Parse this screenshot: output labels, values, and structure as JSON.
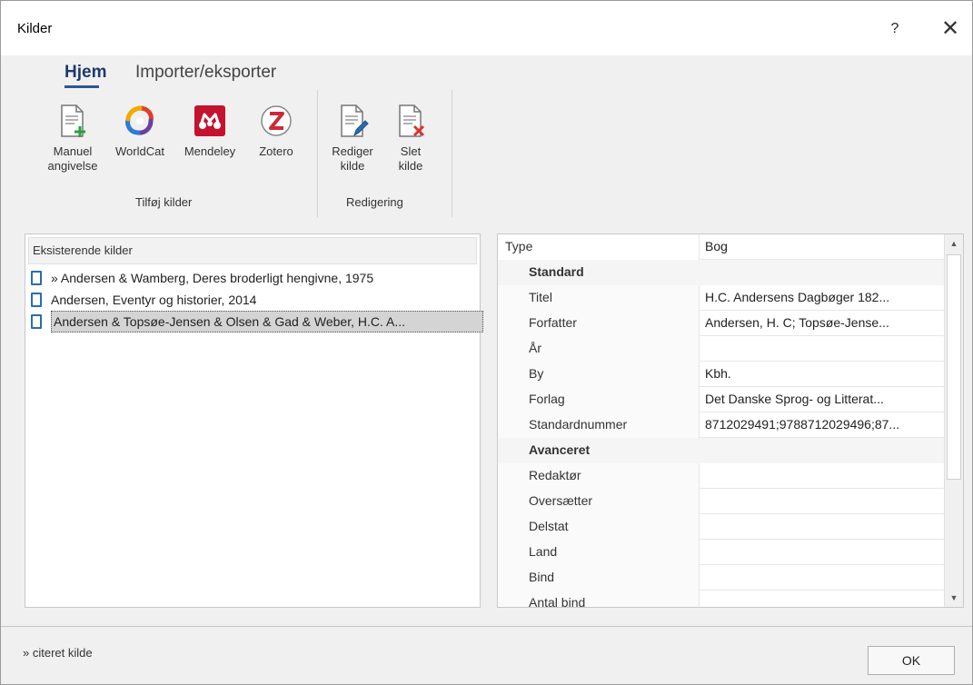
{
  "window": {
    "title": "Kilder",
    "help_label": "?",
    "close_label": "✕"
  },
  "ribbon": {
    "tabs": [
      {
        "label": "Hjem",
        "active": true
      },
      {
        "label": "Importer/eksporter",
        "active": false
      }
    ],
    "groups": [
      {
        "label": "Tilføj kilder",
        "buttons": [
          {
            "label": "Manuel angivelse",
            "line1": "Manuel",
            "line2": "angivelse",
            "icon": "manual-entry-icon"
          },
          {
            "label": "WorldCat",
            "icon": "worldcat-icon"
          },
          {
            "label": "Mendeley",
            "icon": "mendeley-icon"
          },
          {
            "label": "Zotero",
            "icon": "zotero-icon"
          }
        ]
      },
      {
        "label": "Redigering",
        "buttons": [
          {
            "label": "Rediger kilde",
            "line1": "Rediger",
            "line2": "kilde",
            "icon": "edit-source-icon"
          },
          {
            "label": "Slet kilde",
            "line1": "Slet",
            "line2": "kilde",
            "icon": "delete-source-icon"
          }
        ]
      }
    ]
  },
  "sources": {
    "header": "Eksisterende kilder",
    "items": [
      {
        "text": "» Andersen & Wamberg, Deres broderligt hengivne, 1975",
        "selected": false
      },
      {
        "text": "Andersen, Eventyr og historier, 2014",
        "selected": false
      },
      {
        "text": "Andersen & Topsøe-Jensen & Olsen & Gad & Weber, H.C. A...",
        "selected": true
      }
    ]
  },
  "properties": {
    "type_key": "Type",
    "type_value": "Bog",
    "sections": [
      {
        "label": "Standard",
        "rows": [
          {
            "key": "Titel",
            "value": "H.C. Andersens Dagbøger 182..."
          },
          {
            "key": "Forfatter",
            "value": "Andersen, H. C; Topsøe-Jense..."
          },
          {
            "key": "År",
            "value": ""
          },
          {
            "key": "By",
            "value": "Kbh."
          },
          {
            "key": "Forlag",
            "value": "Det Danske Sprog- og Litterat..."
          },
          {
            "key": "Standardnummer",
            "value": "8712029491;9788712029496;87..."
          }
        ]
      },
      {
        "label": "Avanceret",
        "rows": [
          {
            "key": "Redaktør",
            "value": ""
          },
          {
            "key": "Oversætter",
            "value": ""
          },
          {
            "key": "Delstat",
            "value": ""
          },
          {
            "key": "Land",
            "value": ""
          },
          {
            "key": "Bind",
            "value": ""
          },
          {
            "key": "Antal bind",
            "value": ""
          }
        ]
      }
    ]
  },
  "footer": {
    "note": "» citeret kilde",
    "ok_label": "OK"
  },
  "colors": {
    "accent": "#2b579a",
    "worldcat": "#6b3fa0",
    "mendeley": "#c4122f",
    "zotero": "#cc2936",
    "delete": "#d9352f",
    "add": "#2e9e3e"
  }
}
